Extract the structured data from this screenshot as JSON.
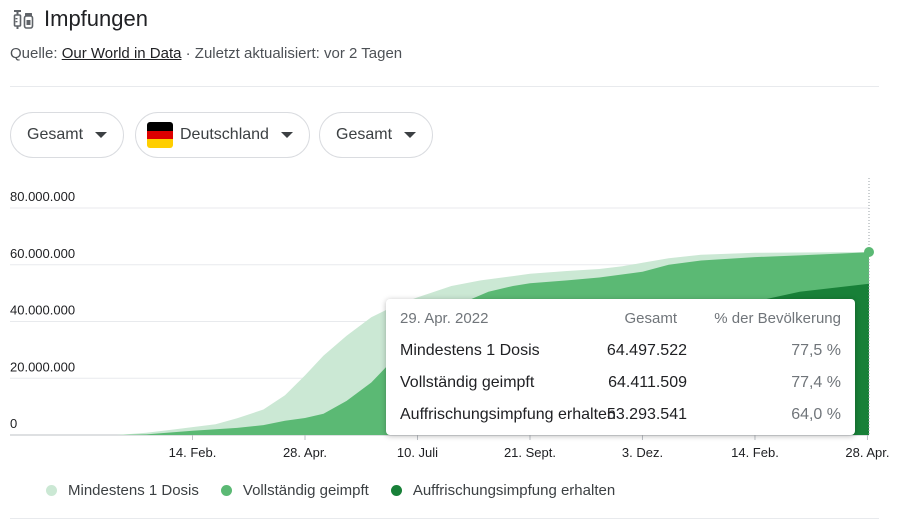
{
  "header": {
    "title": "Impfungen",
    "icon": "syringe-vial-icon",
    "source_prefix": "Quelle: ",
    "source_link": "Our World in Data",
    "source_suffix": " · Zuletzt aktualisiert: vor 2 Tagen"
  },
  "filters": {
    "metric": "Gesamt",
    "country": "Deutschland",
    "country_flag": "germany-flag-icon",
    "mode": "Gesamt"
  },
  "tooltip": {
    "date": "29. Apr. 2022",
    "col_total": "Gesamt",
    "col_pct": "% der Bevölkerung",
    "rows": [
      {
        "label": "Mindestens 1 Dosis",
        "total": "64.497.522",
        "pct": "77,5 %"
      },
      {
        "label": "Vollständig geimpft",
        "total": "64.411.509",
        "pct": "77,4 %"
      },
      {
        "label": "Auffrischungsimpfung erhalten",
        "total": "53.293.541",
        "pct": "64,0 %"
      }
    ]
  },
  "chart_data": {
    "type": "area",
    "x_ticks": [
      "14. Feb.",
      "28. Apr.",
      "10. Juli",
      "21. Sept.",
      "3. Dez.",
      "14. Feb.",
      "28. Apr."
    ],
    "y_ticks": [
      "0",
      "20.000.000",
      "40.000.000",
      "60.000.000",
      "80.000.000"
    ],
    "ylim": [
      0,
      80000000
    ],
    "x_domain": [
      "2020-12-27",
      "2022-04-29"
    ],
    "x_tick_dates": [
      "2021-02-14",
      "2021-04-28",
      "2021-07-10",
      "2021-09-21",
      "2021-12-03",
      "2022-02-14",
      "2022-04-28"
    ],
    "series": [
      {
        "name": "Mindestens 1 Dosis",
        "color": "#cbe8d4",
        "x": [
          "2020-12-27",
          "2021-01-15",
          "2021-02-01",
          "2021-02-14",
          "2021-03-01",
          "2021-03-15",
          "2021-04-01",
          "2021-04-15",
          "2021-04-28",
          "2021-05-10",
          "2021-05-25",
          "2021-06-10",
          "2021-06-25",
          "2021-07-10",
          "2021-08-01",
          "2021-08-20",
          "2021-09-10",
          "2021-09-21",
          "2021-10-15",
          "2021-11-05",
          "2021-11-20",
          "2021-12-03",
          "2021-12-20",
          "2022-01-10",
          "2022-02-14",
          "2022-03-15",
          "2022-04-29"
        ],
        "values": [
          0,
          800000,
          1900000,
          2800000,
          3800000,
          5900000,
          9000000,
          14000000,
          21000000,
          28000000,
          35000000,
          41500000,
          45500000,
          48500000,
          52500000,
          54500000,
          56000000,
          56800000,
          57800000,
          58500000,
          59500000,
          60700000,
          62300000,
          63500000,
          64200000,
          64300000,
          64497522
        ]
      },
      {
        "name": "Vollständig geimpft",
        "color": "#5bb974",
        "x": [
          "2020-12-27",
          "2021-01-15",
          "2021-02-14",
          "2021-03-15",
          "2021-04-01",
          "2021-04-15",
          "2021-04-28",
          "2021-05-10",
          "2021-05-25",
          "2021-06-10",
          "2021-06-25",
          "2021-07-10",
          "2021-07-25",
          "2021-08-10",
          "2021-08-25",
          "2021-09-10",
          "2021-09-21",
          "2021-10-15",
          "2021-11-05",
          "2021-12-03",
          "2021-12-20",
          "2022-01-10",
          "2022-02-14",
          "2022-03-15",
          "2022-04-29"
        ],
        "values": [
          0,
          200000,
          1500000,
          2500000,
          3500000,
          5000000,
          6000000,
          7500000,
          12000000,
          18500000,
          27000000,
          35000000,
          42000000,
          47000000,
          50500000,
          52500000,
          53500000,
          54500000,
          55500000,
          57500000,
          60000000,
          61500000,
          62700000,
          63300000,
          64411509
        ]
      },
      {
        "name": "Auffrischungsimpfung erhalten",
        "color": "#188038",
        "x": [
          "2020-12-27",
          "2021-08-10",
          "2021-09-10",
          "2021-10-15",
          "2021-11-05",
          "2021-11-20",
          "2021-12-03",
          "2021-12-20",
          "2022-01-10",
          "2022-02-01",
          "2022-02-14",
          "2022-03-15",
          "2022-04-29"
        ],
        "values": [
          0,
          0,
          300000,
          1200000,
          3000000,
          7000000,
          13000000,
          24000000,
          36000000,
          44000000,
          47000000,
          50500000,
          53293541
        ]
      }
    ],
    "selected_x": "2022-04-29"
  },
  "legend": {
    "items": [
      {
        "label": "Mindestens 1 Dosis",
        "color": "#cbe8d4"
      },
      {
        "label": "Vollständig geimpft",
        "color": "#5bb974"
      },
      {
        "label": "Auffrischungsimpfung erhalten",
        "color": "#188038"
      }
    ]
  }
}
